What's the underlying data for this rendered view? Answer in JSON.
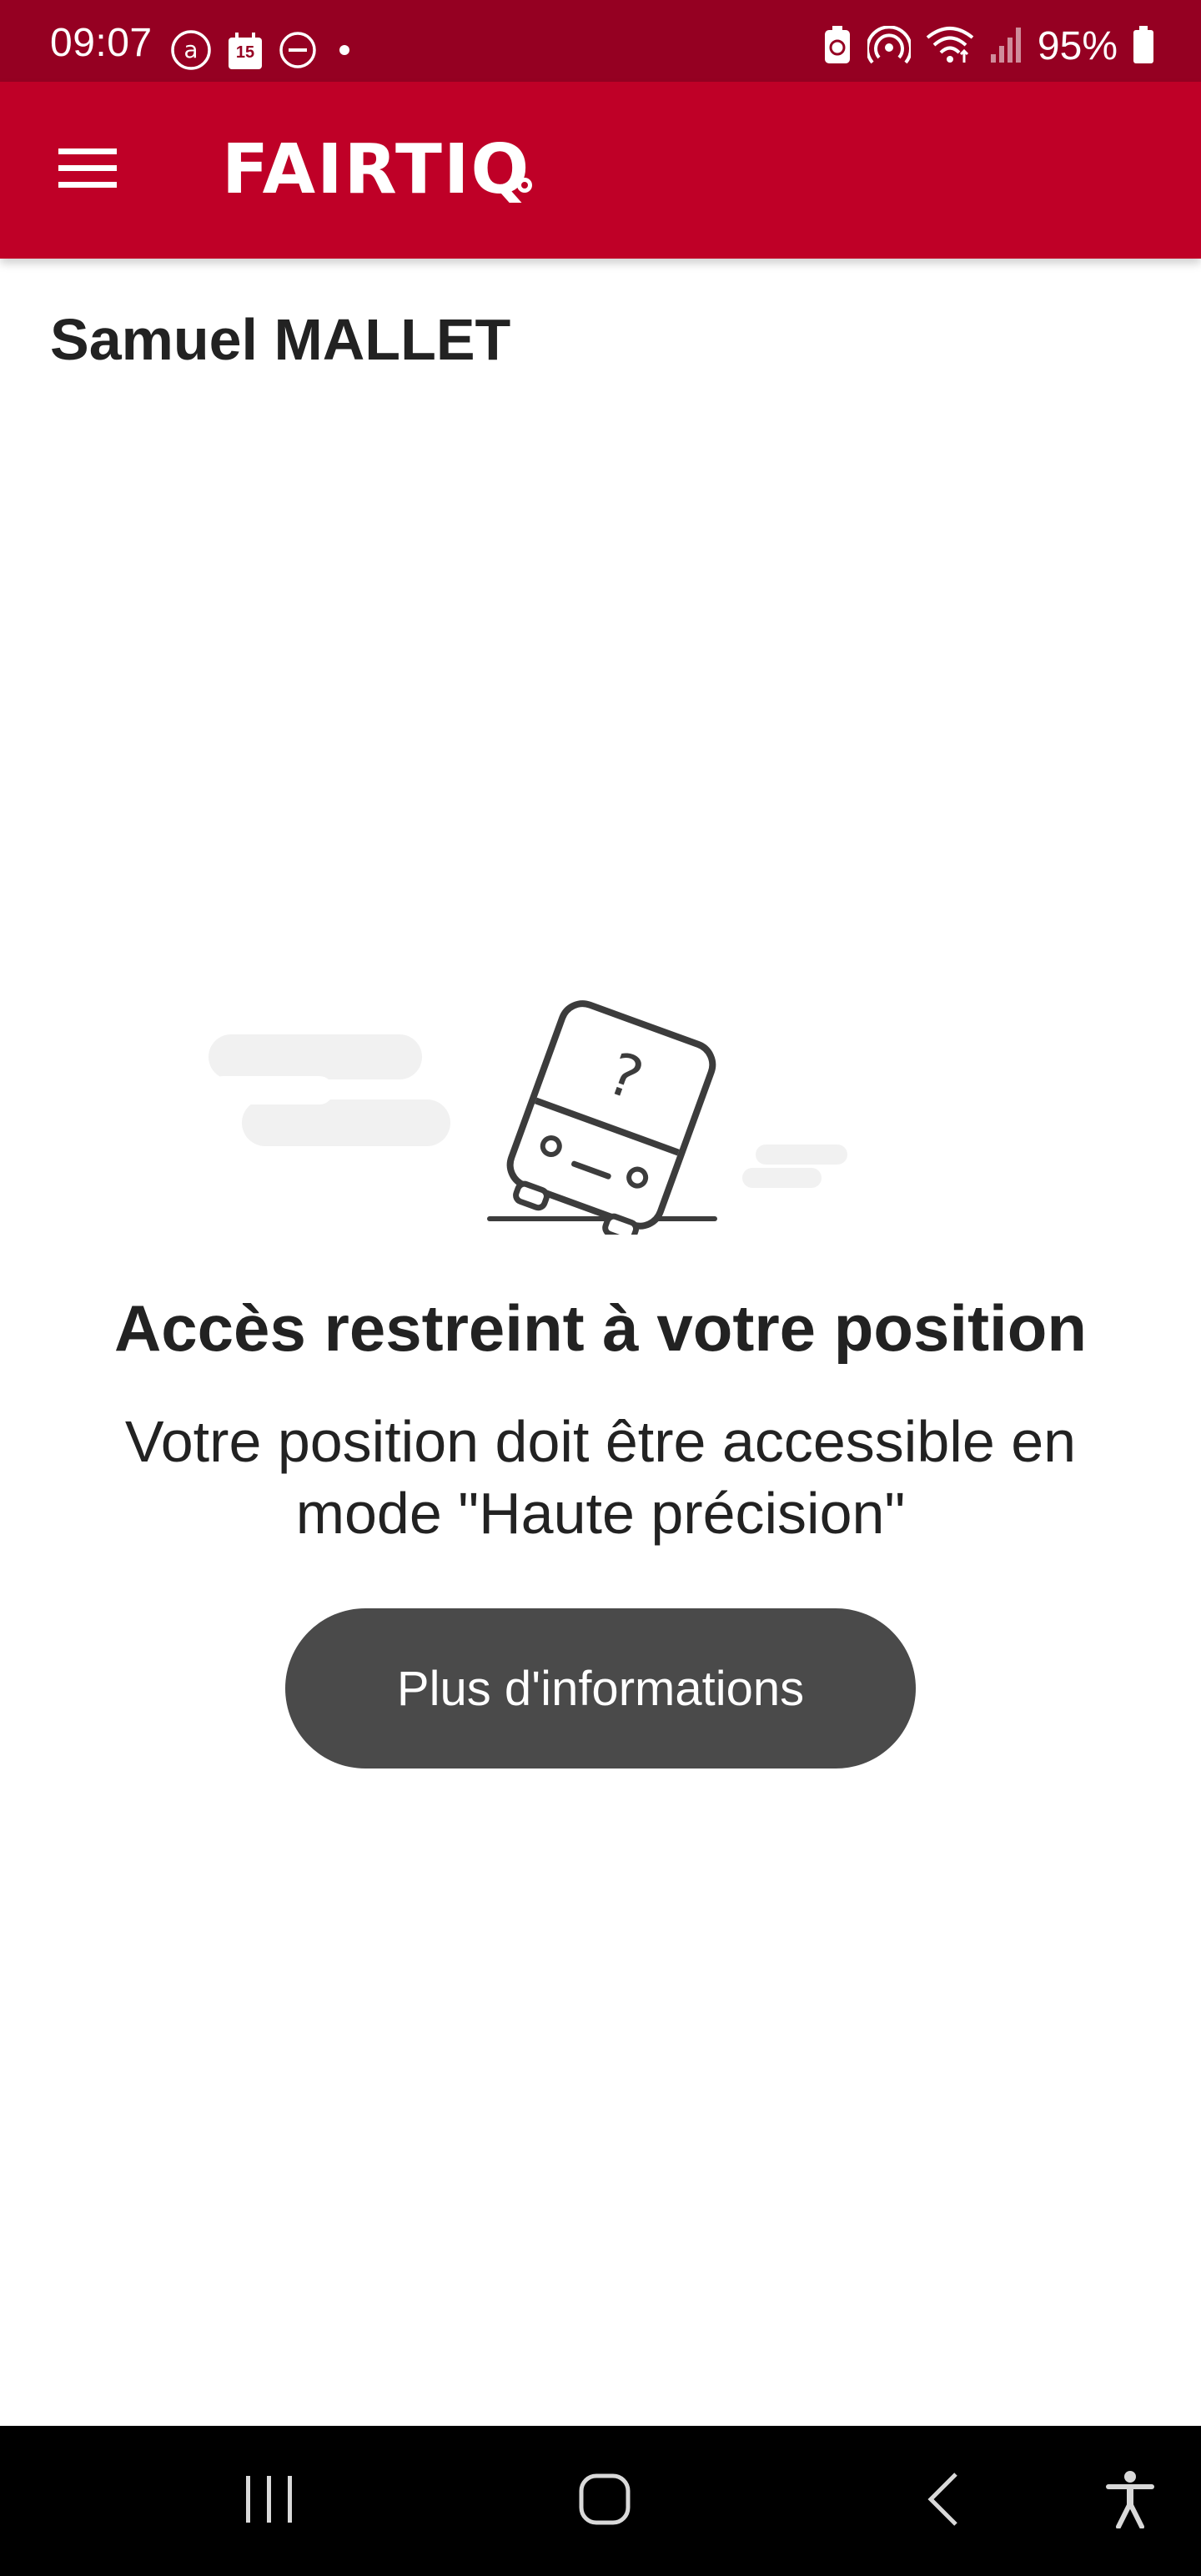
{
  "status_bar": {
    "time": "09:07",
    "battery_percent": "95%",
    "calendar_day": "15",
    "left_icons": [
      "at-sign-icon",
      "calendar-icon",
      "do-not-disturb-icon",
      "notification-dot-icon"
    ],
    "right_icons": [
      "battery-saver-icon",
      "hotspot-icon",
      "wifi-icon",
      "signal-icon",
      "battery-icon"
    ]
  },
  "app_bar": {
    "menu_icon": "hamburger-menu-icon",
    "logo_text": "FAIRTIQ",
    "background_color": "#bf0027"
  },
  "profile": {
    "name": "Samuel MALLET"
  },
  "error_state": {
    "illustration": "tilted-bus-question-mark-illustration",
    "title": "Accès restreint à votre position",
    "message": "Votre position doit être accessible en mode \"Haute précision\"",
    "button_label": "Plus d'informations",
    "button_color": "#4a4a4a"
  },
  "nav_bar": {
    "buttons": [
      "recent-apps-icon",
      "home-icon",
      "back-icon",
      "accessibility-icon"
    ]
  }
}
